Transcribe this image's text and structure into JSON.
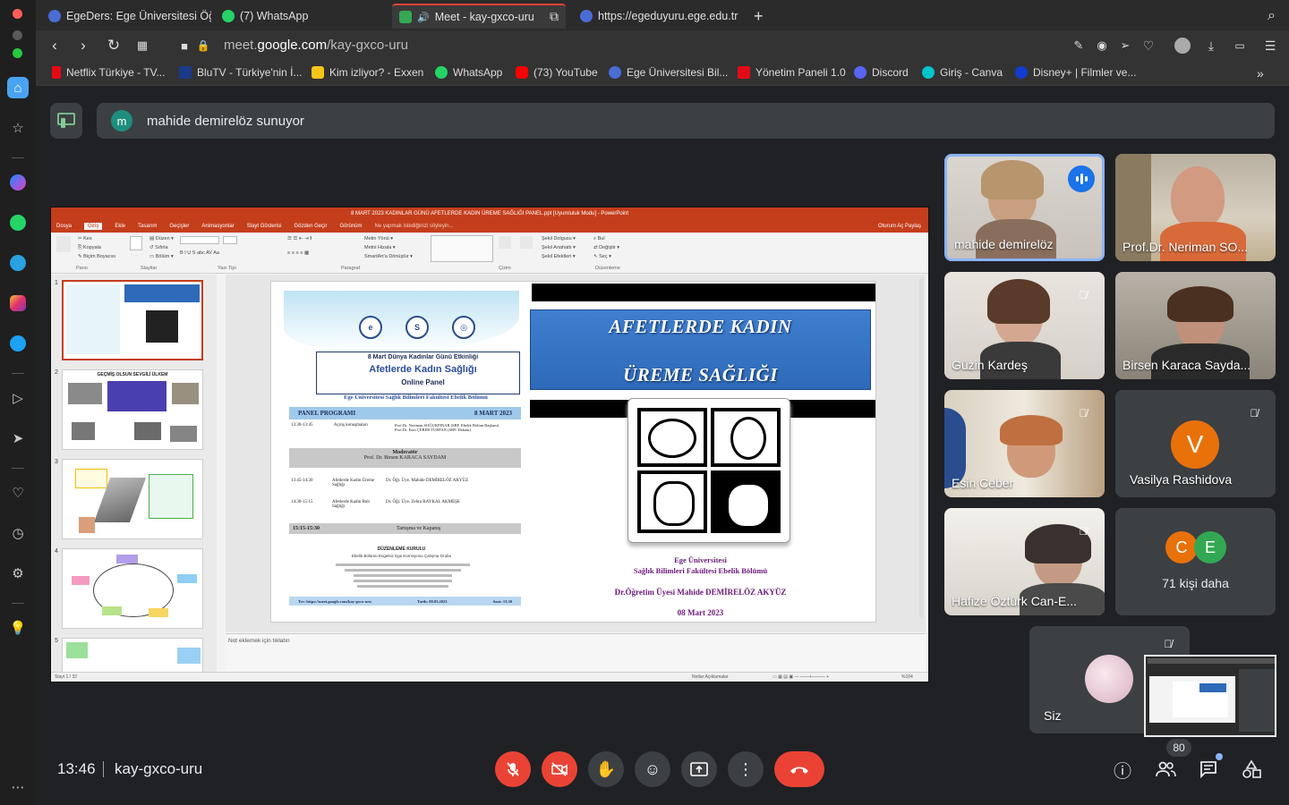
{
  "browser": {
    "tabs": [
      {
        "label": "EgeDers: Ege Üniversitesi Öğre",
        "color": "#4a6cd4"
      },
      {
        "label": "(7) WhatsApp",
        "color": "#25d366"
      },
      {
        "label": "Meet - kay-gxco-uru",
        "color": "#34a853"
      },
      {
        "label": "https://egeduyuru.ege.edu.tr",
        "color": "#4a6cd4"
      }
    ],
    "url_prefix": "meet.",
    "url_domain": "google.com",
    "url_path": "/kay-gxco-uru",
    "bookmarks": [
      {
        "label": "Netflix Türkiye - TV...",
        "color": "#e50914"
      },
      {
        "label": "BluTV - Türkiye'nin İ...",
        "color": "#1a3a8a"
      },
      {
        "label": "Kim izliyor? - Exxen",
        "color": "#f5c518"
      },
      {
        "label": "WhatsApp",
        "color": "#25d366"
      },
      {
        "label": "(73) YouTube",
        "color": "#ff0000"
      },
      {
        "label": "Ege Üniversitesi Bil...",
        "color": "#4a6cd4"
      },
      {
        "label": "Yönetim Paneli 1.0",
        "color": "#e30a17"
      },
      {
        "label": "Discord",
        "color": "#5865f2"
      },
      {
        "label": "Giriş - Canva",
        "color": "#00c4cc"
      },
      {
        "label": "Disney+ | Filmler ve...",
        "color": "#113ccf"
      }
    ]
  },
  "meet": {
    "presenter_initial": "m",
    "presenter_text": "mahide demirelöz sunuyor",
    "time": "13:46",
    "code": "kay-gxco-uru",
    "participant_count": "80",
    "participants": [
      {
        "name": "mahide demirelöz"
      },
      {
        "name": "Prof.Dr. Neriman SO..."
      },
      {
        "name": "Güzin Kardeş"
      },
      {
        "name": "Birsen Karaca Sayda..."
      },
      {
        "name": "Esin Ceber"
      },
      {
        "name": "Vasilya Rashidova",
        "initial": "V"
      },
      {
        "name": "Hafize Öztürk Can-E..."
      },
      {
        "name": "71 kişi daha",
        "initials": [
          "C",
          "E"
        ]
      },
      {
        "name": "Siz"
      }
    ]
  },
  "ppt": {
    "title": "8 MART 2023 KADINLAR GÜNÜ AFETLERDE KADIN ÜREME SAĞLIĞI PANEL.ppt [Uyumluluk Modu] - PowerPoint",
    "menu": [
      "Dosya",
      "Giriş",
      "Ekle",
      "Tasarım",
      "Geçişler",
      "Animasyonlar",
      "Slayt Gösterisi",
      "Gözden Geçir",
      "Görünüm"
    ],
    "tell_me": "Ne yapmak istediğinizi söyleyin...",
    "share": "Oturum Aç   Paylaş",
    "groups": [
      "Pano",
      "Slaytlar",
      "Yazı Tipi",
      "Paragraf",
      "Çizim",
      "Düzenleme"
    ],
    "notes_placeholder": "Not eklemek için tıklatın",
    "status_left": "Slayt 1 / 32",
    "status_right": "Notlar   Açıklamalar",
    "zoom": "%104",
    "thumb2_title": "GEÇMİŞ OLSUN SEVGİLİ ÜLKEM",
    "slide": {
      "title_line1": "AFETLERDE KADIN",
      "title_line2": "ÜREME SAĞLIĞI",
      "caption1": "Ege Üniversitesi",
      "caption2": "Sağlık Bilimleri Fakültesi Ebelik Bölümü",
      "author": "Dr.Öğretim Üyesi Mahide DEMİRELÖZ AKYÜZ",
      "date": "08 Mart 2023"
    },
    "poster": {
      "line1": "8 Mart Dünya Kadınlar Günü Etkinliği",
      "line2": "Afetlerde Kadın Sağlığı",
      "line3": "Online Panel",
      "line4": "Ege Üniversitesi Sağlık Bilimleri Fakültesi Ebelik Bölümü",
      "program": "PANEL PROGRAMI",
      "program_date": "8 MART 2023",
      "row1_time": "13:30-13:45",
      "row1_title": "Açılış konuşmaları",
      "row1_people": "Prof.Dr. Neriman SOĞUKPINAR (SBF. Ebelik Bölüm Başkanı) Prof.Dr. Esin ÇEBER TURFAN (SBF. Dekanı)",
      "moderator": "Moderatör",
      "moderator_name": "Prof. Dr. Birsen KARACA SAYDAM",
      "row2_time": "13:45-14:30",
      "row2_title": "Afetlerde Kadın Üreme Sağlığı",
      "row2_people": "Dr. Öğr. Üye. Mahide DEMİRELÖZ AKYÜZ",
      "row3_time": "14:30-15:15",
      "row3_title": "Afetlerde Kadın Ruh Sağlığı",
      "row3_people": "Dr. Öğr. Üye. Zehra BAYKAL AKMEŞE",
      "row4_time": "15:15-15:30",
      "row4_title": "Tartışma ve Kapanış",
      "committee": "DÜZENLEME KURULU",
      "committee_sub": "Ebelik Bölümü Engelsiz Ege Komisyonu Çalışma Grubu",
      "footer_link": "Ter: https://meet.google.com/kay-gxco-uru",
      "footer_date": "Tarih: 08.03.2023",
      "footer_time": "Saat: 13.30"
    }
  }
}
